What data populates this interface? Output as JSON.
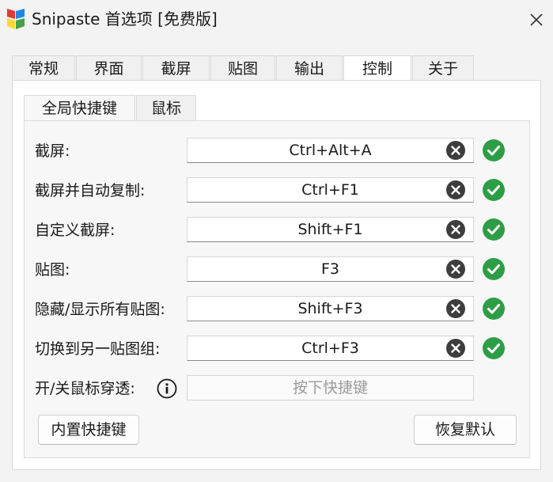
{
  "window": {
    "title": "Snipaste 首选项 [免费版]"
  },
  "main_tabs": [
    {
      "label": "常规"
    },
    {
      "label": "界面"
    },
    {
      "label": "截屏"
    },
    {
      "label": "贴图"
    },
    {
      "label": "输出"
    },
    {
      "label": "控制",
      "active": true
    },
    {
      "label": "关于"
    }
  ],
  "sub_tabs": [
    {
      "label": "全局快捷键",
      "active": true
    },
    {
      "label": "鼠标"
    }
  ],
  "hotkeys": [
    {
      "label": "截屏:",
      "value": "Ctrl+Alt+A",
      "status": "ok"
    },
    {
      "label": "截屏并自动复制:",
      "value": "Ctrl+F1",
      "status": "ok"
    },
    {
      "label": "自定义截屏:",
      "value": "Shift+F1",
      "status": "ok"
    },
    {
      "label": "贴图:",
      "value": "F3",
      "status": "ok"
    },
    {
      "label": "隐藏/显示所有贴图:",
      "value": "Shift+F3",
      "status": "ok"
    },
    {
      "label": "切换到另一贴图组:",
      "value": "Ctrl+F3",
      "status": "ok"
    }
  ],
  "mouse_passthrough": {
    "label": "开/关鼠标穿透:",
    "placeholder": "按下快捷键"
  },
  "buttons": {
    "builtin": "内置快捷键",
    "restore": "恢复默认"
  },
  "colors": {
    "check": "#2e9e46",
    "clear": "#3d3d3d",
    "tab_active": "#ffffff",
    "subpanel": "#f7f7f7"
  },
  "icons": {
    "app": "snipaste-logo-icon",
    "close": "close-icon",
    "clear": "clear-circle-icon",
    "check": "check-circle-icon",
    "info": "info-circle-icon"
  }
}
